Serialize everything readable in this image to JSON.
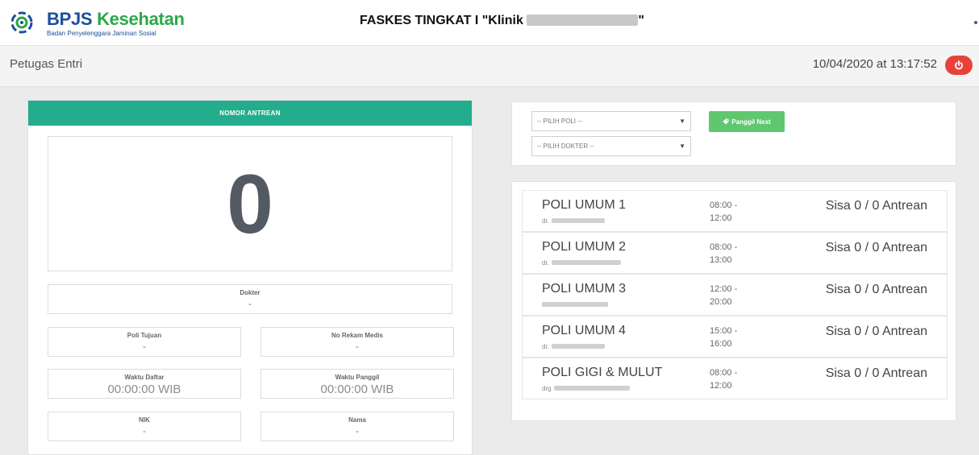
{
  "header": {
    "logo_name": "BPJS",
    "logo_name_2": "Kesehatan",
    "logo_subtitle": "Badan Penyelenggara Jaminan Sosial",
    "faskes_prefix": "FASKES TINGKAT I \"Klinik",
    "faskes_suffix": "\""
  },
  "userbar": {
    "role": "Petugas Entri",
    "datetime": "10/04/2020 at 13:17:52"
  },
  "antrean": {
    "title": "NOMOR ANTREAN",
    "number": "0",
    "dokter": {
      "label": "Dokter",
      "value": "-"
    },
    "poli_tujuan": {
      "label": "Poli Tujuan",
      "value": "-"
    },
    "no_rekam_medis": {
      "label": "No Rekam Medis",
      "value": "-"
    },
    "waktu_daftar": {
      "label": "Waktu Daftar",
      "value": "00:00:00 WIB"
    },
    "waktu_panggil": {
      "label": "Waktu Panggil",
      "value": "00:00:00 WIB"
    },
    "nik": {
      "label": "NIK",
      "value": "-"
    },
    "nama": {
      "label": "Nama",
      "value": "-"
    }
  },
  "controls": {
    "pilih_poli": "-- PILIH POLI --",
    "pilih_dokter": "-- PILIH DOKTER --",
    "panggil_next": "Panggil Next"
  },
  "poli_list": [
    {
      "name": "POLI UMUM 1",
      "doc_prefix": "dr.",
      "time_start": "08:00 -",
      "time_end": "12:00",
      "sisa": "Sisa 0 / 0 Antrean"
    },
    {
      "name": "POLI UMUM 2",
      "doc_prefix": "dr.",
      "time_start": "08:00 -",
      "time_end": "13:00",
      "sisa": "Sisa 0 / 0 Antrean"
    },
    {
      "name": "POLI UMUM 3",
      "doc_prefix": "",
      "time_start": "12:00 -",
      "time_end": "20:00",
      "sisa": "Sisa 0 / 0 Antrean"
    },
    {
      "name": "POLI UMUM 4",
      "doc_prefix": "dr.",
      "time_start": "15:00 -",
      "time_end": "16:00",
      "sisa": "Sisa 0 / 0 Antrean"
    },
    {
      "name": "POLI GIGI & MULUT",
      "doc_prefix": "drg",
      "time_start": "08:00 -",
      "time_end": "12:00",
      "sisa": "Sisa 0 / 0 Antrean"
    }
  ],
  "colors": {
    "header_green": "#23ad8d",
    "button_green": "#60c770",
    "logout_red": "#e8413a",
    "brand_blue": "#1b4f9c"
  },
  "icons": {
    "logo": "bpjs-logo-icon",
    "logout": "power-icon",
    "next": "tag-icon",
    "select_caret": "caret-down-icon"
  }
}
